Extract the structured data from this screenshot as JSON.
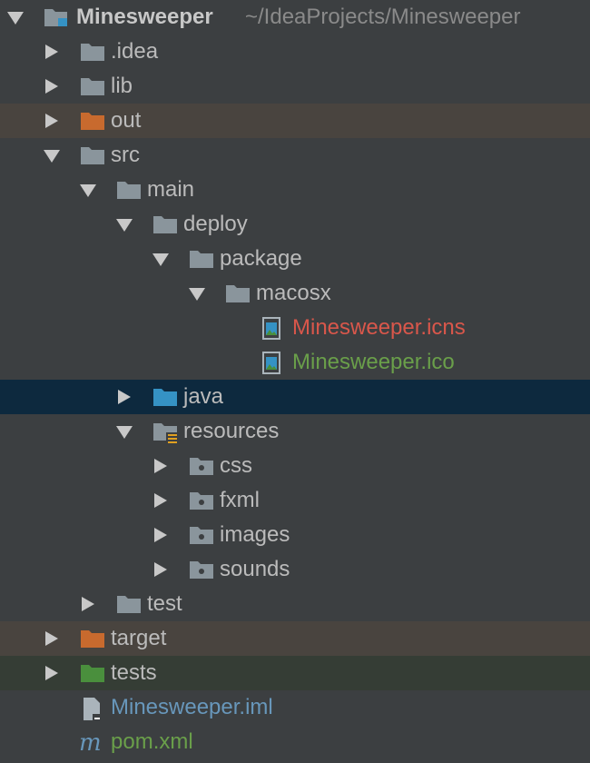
{
  "project": {
    "name": "Minesweeper",
    "path": "~/IdeaProjects/Minesweeper"
  },
  "tree": {
    "idea": ".idea",
    "lib": "lib",
    "out": "out",
    "src": "src",
    "main": "main",
    "deploy": "deploy",
    "package": "package",
    "macosx": "macosx",
    "icns": "Minesweeper.icns",
    "ico": "Minesweeper.ico",
    "java": "java",
    "resources": "resources",
    "css": "css",
    "fxml": "fxml",
    "images": "images",
    "sounds": "sounds",
    "test": "test",
    "target": "target",
    "tests": "tests",
    "iml": "Minesweeper.iml",
    "pom": "pom.xml"
  },
  "colors": {
    "background": "#3c3f41",
    "text": "#bbbbbb",
    "folder": "#8a959c",
    "excluded_folder": "#c86a2e",
    "source_folder": "#3592c4",
    "test_folder": "#4a8f3d",
    "modified_red": "#d9574b",
    "added_green": "#6a9f4a",
    "iml_blue": "#6897bb"
  },
  "icons": {
    "folder": "folder-icon",
    "module": "module-folder-icon",
    "image_file": "image-file-icon",
    "iml_file": "iml-file-icon",
    "maven": "maven-icon"
  }
}
